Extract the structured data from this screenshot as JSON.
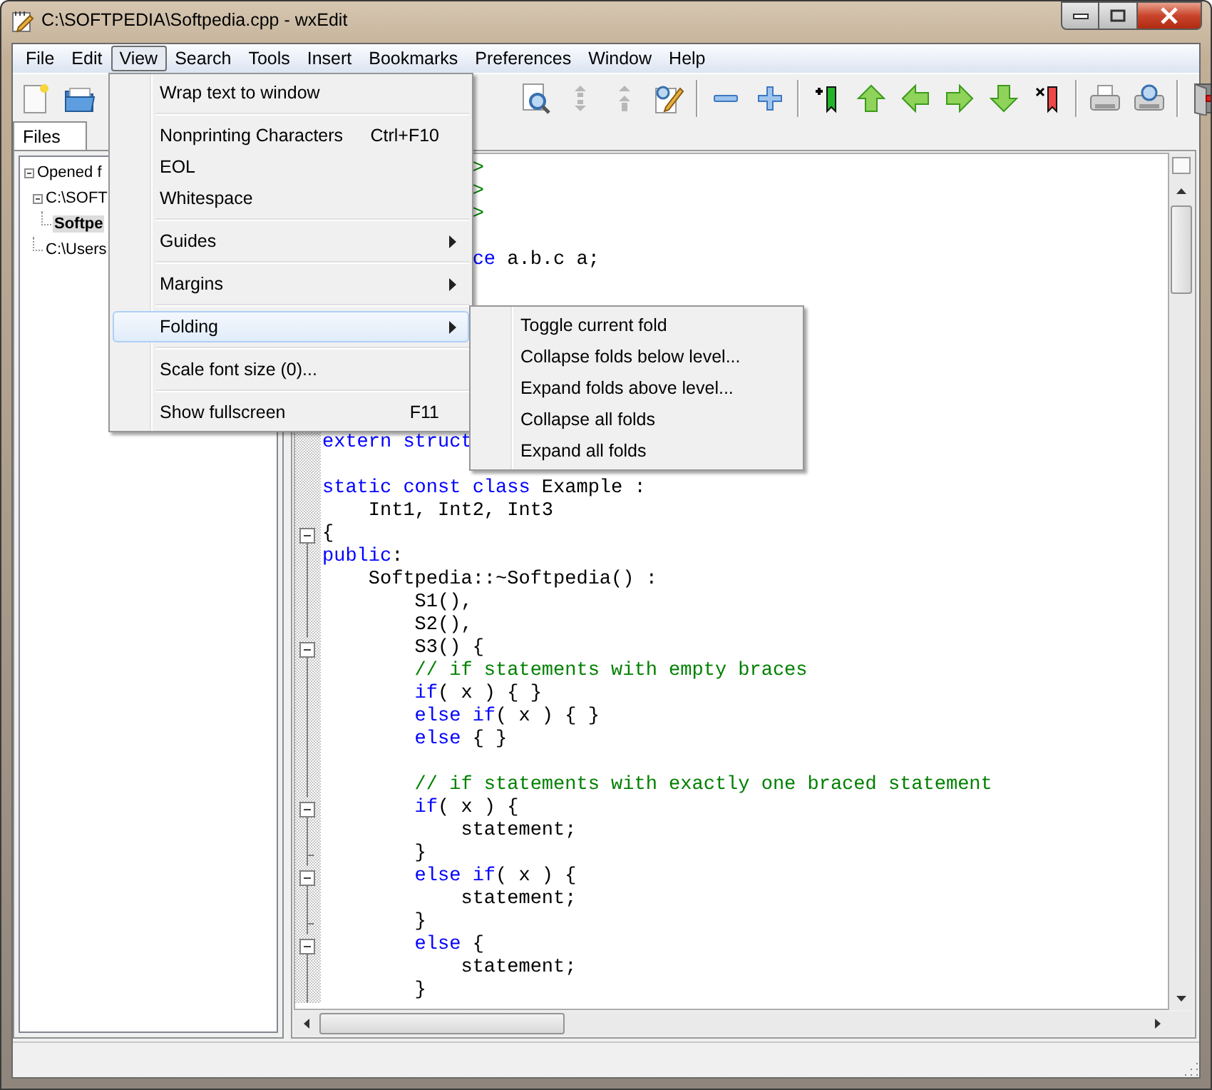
{
  "window": {
    "title": "C:\\SOFTPEDIA\\Softpedia.cpp - wxEdit"
  },
  "menubar": [
    {
      "label": "File",
      "selected": false
    },
    {
      "label": "Edit",
      "selected": false
    },
    {
      "label": "View",
      "selected": true
    },
    {
      "label": "Search",
      "selected": false
    },
    {
      "label": "Tools",
      "selected": false
    },
    {
      "label": "Insert",
      "selected": false
    },
    {
      "label": "Bookmarks",
      "selected": false
    },
    {
      "label": "Preferences",
      "selected": false
    },
    {
      "label": "Window",
      "selected": false
    },
    {
      "label": "Help",
      "selected": false
    }
  ],
  "view_menu": {
    "items": [
      {
        "kind": "item",
        "label": "Wrap text to window",
        "submenu": false,
        "selected": false
      },
      {
        "kind": "separator"
      },
      {
        "kind": "item",
        "label": "Nonprinting Characters",
        "shortcut": "Ctrl+F10",
        "submenu": false,
        "selected": false
      },
      {
        "kind": "item",
        "label": "EOL",
        "submenu": false,
        "selected": false
      },
      {
        "kind": "item",
        "label": "Whitespace",
        "submenu": false,
        "selected": false
      },
      {
        "kind": "separator"
      },
      {
        "kind": "item",
        "label": "Guides",
        "submenu": true,
        "selected": false
      },
      {
        "kind": "separator"
      },
      {
        "kind": "item",
        "label": "Margins",
        "submenu": true,
        "selected": false
      },
      {
        "kind": "separator"
      },
      {
        "kind": "item",
        "label": "Folding",
        "submenu": true,
        "selected": true
      },
      {
        "kind": "separator"
      },
      {
        "kind": "item",
        "label": "Scale font size (0)...",
        "submenu": false,
        "selected": false
      },
      {
        "kind": "separator"
      },
      {
        "kind": "item",
        "label": "Show fullscreen",
        "shortcut": "F11",
        "submenu": false,
        "selected": false
      }
    ]
  },
  "folding_submenu": {
    "items": [
      {
        "label": "Toggle current fold",
        "selected": false
      },
      {
        "label": "Collapse folds below level...",
        "selected": false
      },
      {
        "label": "Expand folds above level...",
        "selected": false
      },
      {
        "label": "Collapse all folds",
        "selected": false
      },
      {
        "label": "Expand all folds",
        "selected": false
      }
    ]
  },
  "sidebar": {
    "tabs": [
      {
        "label": "Files",
        "selected": true
      }
    ],
    "tree": [
      {
        "label": "Opened f",
        "selected": false,
        "children": [
          {
            "label": "C:\\SOFT",
            "selected": false,
            "children": [
              {
                "label": "Softpe",
                "selected": true
              }
            ]
          },
          {
            "label": "C:\\Users",
            "selected": false
          }
        ]
      }
    ]
  },
  "editor": {
    "lines": [
      {
        "kind": "plain",
        "segments": [
          {
            "kind": "preprocessor",
            "text": "             >"
          }
        ]
      },
      {
        "kind": "plain",
        "segments": [
          {
            "kind": "preprocessor",
            "text": "             >"
          }
        ]
      },
      {
        "kind": "plain",
        "segments": [
          {
            "kind": "preprocessor",
            "text": "             >"
          }
        ]
      },
      {
        "kind": "plain"
      },
      {
        "kind": "plain",
        "segments": [
          {
            "kind": "keyword",
            "text": "             ce"
          },
          {
            "kind": "plain",
            "text": " a.b.c a;"
          }
        ]
      },
      {
        "kind": "plain"
      },
      {
        "kind": "plain"
      },
      {
        "kind": "plain"
      },
      {
        "kind": "plain"
      },
      {
        "kind": "plain"
      },
      {
        "kind": "plain"
      },
      {
        "kind": "plain"
      },
      {
        "kind": "plain",
        "segments": [
          {
            "kind": "keyword",
            "text": "extern struct"
          }
        ]
      },
      {
        "kind": "plain"
      },
      {
        "kind": "plain",
        "segments": [
          {
            "kind": "keyword",
            "text": "static const class"
          },
          {
            "kind": "plain",
            "text": " Example :"
          }
        ]
      },
      {
        "kind": "plain",
        "segments": [
          {
            "kind": "plain",
            "text": "    Int1, Int2, Int3"
          }
        ]
      },
      {
        "kind": "fold_start",
        "segments": [
          {
            "kind": "plain",
            "text": "{"
          }
        ]
      },
      {
        "kind": "fold_body",
        "segments": [
          {
            "kind": "keyword",
            "text": "public"
          },
          {
            "kind": "plain",
            "text": ":"
          }
        ]
      },
      {
        "kind": "fold_body",
        "segments": [
          {
            "kind": "plain",
            "text": "    Softpedia::~Softpedia() :"
          }
        ]
      },
      {
        "kind": "fold_body",
        "segments": [
          {
            "kind": "plain",
            "text": "        S1(),"
          }
        ]
      },
      {
        "kind": "fold_body",
        "segments": [
          {
            "kind": "plain",
            "text": "        S2(),"
          }
        ]
      },
      {
        "kind": "fold_start",
        "segments": [
          {
            "kind": "plain",
            "text": "        S3() {"
          }
        ]
      },
      {
        "kind": "fold_body",
        "segments": [
          {
            "kind": "comment",
            "text": "        // if statements with empty braces"
          }
        ]
      },
      {
        "kind": "fold_body",
        "segments": [
          {
            "kind": "keyword",
            "text": "        if"
          },
          {
            "kind": "plain",
            "text": "( x ) { }"
          }
        ]
      },
      {
        "kind": "fold_body",
        "segments": [
          {
            "kind": "keyword",
            "text": "        else if"
          },
          {
            "kind": "plain",
            "text": "( x ) { }"
          }
        ]
      },
      {
        "kind": "fold_body",
        "segments": [
          {
            "kind": "keyword",
            "text": "        else"
          },
          {
            "kind": "plain",
            "text": " { }"
          }
        ]
      },
      {
        "kind": "fold_body"
      },
      {
        "kind": "fold_body",
        "segments": [
          {
            "kind": "comment",
            "text": "        // if statements with exactly one braced statement"
          }
        ]
      },
      {
        "kind": "fold_start",
        "segments": [
          {
            "kind": "keyword",
            "text": "        if"
          },
          {
            "kind": "plain",
            "text": "( x ) {"
          }
        ]
      },
      {
        "kind": "fold_body",
        "segments": [
          {
            "kind": "plain",
            "text": "            statement;"
          }
        ]
      },
      {
        "kind": "fold_end",
        "segments": [
          {
            "kind": "plain",
            "text": "        }"
          }
        ]
      },
      {
        "kind": "fold_start",
        "segments": [
          {
            "kind": "keyword",
            "text": "        else if"
          },
          {
            "kind": "plain",
            "text": "( x ) {"
          }
        ]
      },
      {
        "kind": "fold_body",
        "segments": [
          {
            "kind": "plain",
            "text": "            statement;"
          }
        ]
      },
      {
        "kind": "fold_end",
        "segments": [
          {
            "kind": "plain",
            "text": "        }"
          }
        ]
      },
      {
        "kind": "fold_start",
        "segments": [
          {
            "kind": "keyword",
            "text": "        else"
          },
          {
            "kind": "plain",
            "text": " {"
          }
        ]
      },
      {
        "kind": "fold_body",
        "segments": [
          {
            "kind": "plain",
            "text": "            statement;"
          }
        ]
      },
      {
        "kind": "fold_body",
        "segments": [
          {
            "kind": "plain",
            "text": "        }"
          }
        ]
      }
    ]
  }
}
